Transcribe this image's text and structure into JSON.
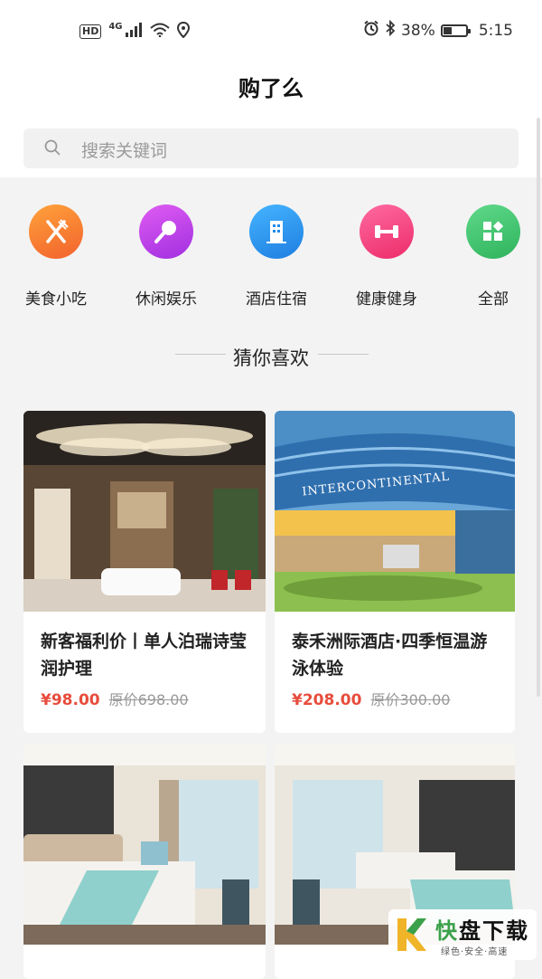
{
  "status_bar": {
    "hd": "HD",
    "network": "4G",
    "battery_percent": "38%",
    "battery_level": 0.38,
    "time": "5:15"
  },
  "header": {
    "title": "购了么"
  },
  "search": {
    "placeholder": "搜索关键词"
  },
  "categories": [
    {
      "label": "美食小吃",
      "icon": "fork-knife-icon",
      "color": "#f2622d"
    },
    {
      "label": "休闲娱乐",
      "icon": "microphone-icon",
      "color": "#b63be6"
    },
    {
      "label": "酒店住宿",
      "icon": "building-icon",
      "color": "#1e8be9"
    },
    {
      "label": "健康健身",
      "icon": "dumbbell-icon",
      "color": "#f13e79"
    },
    {
      "label": "全部",
      "icon": "grid-icon",
      "color": "#3cc26b"
    }
  ],
  "guess_section": {
    "title": "猜你喜欢"
  },
  "products": [
    {
      "title": "新客福利价丨单人泊瑞诗莹润护理",
      "price": "¥98.00",
      "original_price": "原价698.00"
    },
    {
      "title": "泰禾洲际酒店·四季恒温游泳体验",
      "price": "¥208.00",
      "original_price": "原价300.00",
      "image_text": "INTERCONTINENTAL"
    },
    {
      "title": "",
      "price": "",
      "original_price": ""
    },
    {
      "title": "",
      "price": "",
      "original_price": ""
    }
  ],
  "watermark": {
    "text": "快盘下载",
    "sub": "绿色·安全·高速"
  },
  "colors": {
    "price": "#e74c3c",
    "background": "#f3f3f3"
  }
}
